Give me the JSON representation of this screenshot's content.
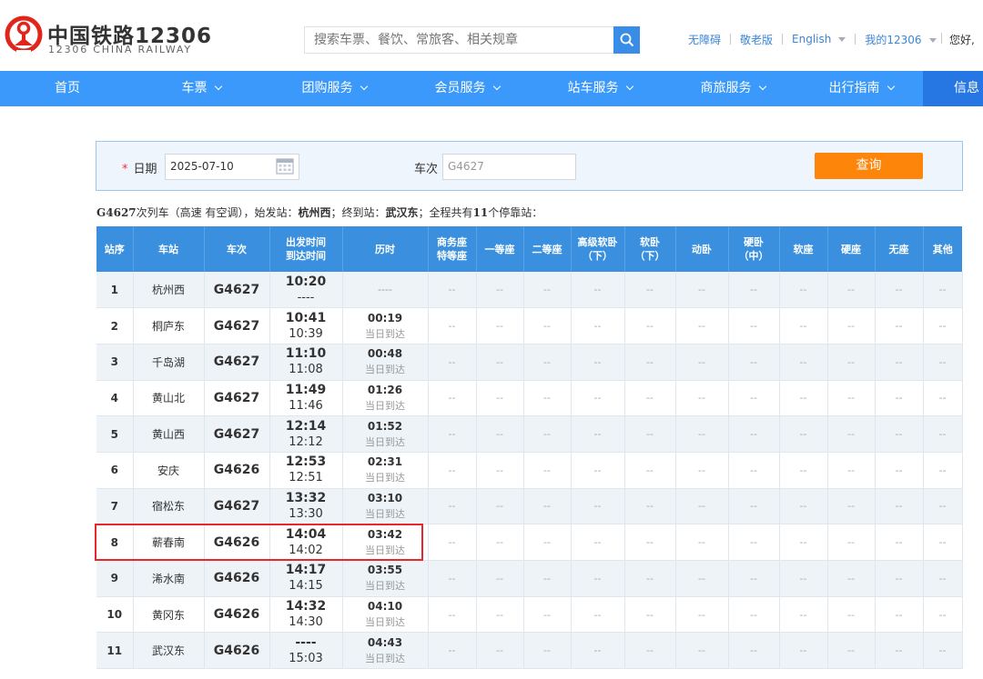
{
  "header": {
    "brand_cn": "中国铁路12306",
    "brand_en": "12306 CHINA RAILWAY",
    "search_placeholder": "搜索车票、餐饮、常旅客、相关规章",
    "links": [
      "无障碍",
      "敬老版",
      "English",
      "我的12306"
    ],
    "greeting": "您好,"
  },
  "nav": {
    "items": [
      {
        "label": "首页"
      },
      {
        "label": "车票"
      },
      {
        "label": "团购服务"
      },
      {
        "label": "会员服务"
      },
      {
        "label": "站车服务"
      },
      {
        "label": "商旅服务"
      },
      {
        "label": "出行指南"
      },
      {
        "label": "信息"
      }
    ]
  },
  "query": {
    "date_label": "日期",
    "date_value": "2025-07-10",
    "train_label": "车次",
    "train_value": "G4627",
    "query_button": "查询"
  },
  "summary": {
    "train": "G4627",
    "t1": "次列车（高速 有空调），始发站：",
    "origin": "杭州西",
    "t2": "；终到站：",
    "dest": "武汉东",
    "t3": "；全程共有",
    "count": "11",
    "t4": "个停靠站："
  },
  "table": {
    "headers": [
      [
        "站序"
      ],
      [
        "车站"
      ],
      [
        "车次"
      ],
      [
        "出发时间",
        "到达时间"
      ],
      [
        "历时"
      ],
      [
        "商务座",
        "特等座"
      ],
      [
        "一等座"
      ],
      [
        "二等座"
      ],
      [
        "高级软卧",
        "（下）"
      ],
      [
        "软卧",
        "（下）"
      ],
      [
        "动卧"
      ],
      [
        "硬卧",
        "（中）"
      ],
      [
        "软座"
      ],
      [
        "硬座"
      ],
      [
        "无座"
      ],
      [
        "其他"
      ]
    ],
    "seat_placeholder": "--",
    "rows": [
      {
        "seq": "1",
        "station": "杭州西",
        "train": "G4627",
        "dep": "10:20",
        "arr": "----",
        "dur": "----",
        "note": ""
      },
      {
        "seq": "2",
        "station": "桐庐东",
        "train": "G4627",
        "dep": "10:41",
        "arr": "10:39",
        "dur": "00:19",
        "note": "当日到达"
      },
      {
        "seq": "3",
        "station": "千岛湖",
        "train": "G4627",
        "dep": "11:10",
        "arr": "11:08",
        "dur": "00:48",
        "note": "当日到达"
      },
      {
        "seq": "4",
        "station": "黄山北",
        "train": "G4627",
        "dep": "11:49",
        "arr": "11:46",
        "dur": "01:26",
        "note": "当日到达"
      },
      {
        "seq": "5",
        "station": "黄山西",
        "train": "G4627",
        "dep": "12:14",
        "arr": "12:12",
        "dur": "01:52",
        "note": "当日到达"
      },
      {
        "seq": "6",
        "station": "安庆",
        "train": "G4626",
        "dep": "12:53",
        "arr": "12:51",
        "dur": "02:31",
        "note": "当日到达"
      },
      {
        "seq": "7",
        "station": "宿松东",
        "train": "G4627",
        "dep": "13:32",
        "arr": "13:30",
        "dur": "03:10",
        "note": "当日到达"
      },
      {
        "seq": "8",
        "station": "蕲春南",
        "train": "G4626",
        "dep": "14:04",
        "arr": "14:02",
        "dur": "03:42",
        "note": "当日到达"
      },
      {
        "seq": "9",
        "station": "浠水南",
        "train": "G4626",
        "dep": "14:17",
        "arr": "14:15",
        "dur": "03:55",
        "note": "当日到达"
      },
      {
        "seq": "10",
        "station": "黄冈东",
        "train": "G4626",
        "dep": "14:32",
        "arr": "14:30",
        "dur": "04:10",
        "note": "当日到达"
      },
      {
        "seq": "11",
        "station": "武汉东",
        "train": "G4626",
        "dep": "----",
        "arr": "15:03",
        "dur": "04:43",
        "note": "当日到达"
      }
    ]
  },
  "colors": {
    "nav_blue": "#3b99fc",
    "table_header": "#3a90de",
    "query_button": "#fd850a",
    "highlight": "#e8262d",
    "logo_red": "#e1251b"
  }
}
